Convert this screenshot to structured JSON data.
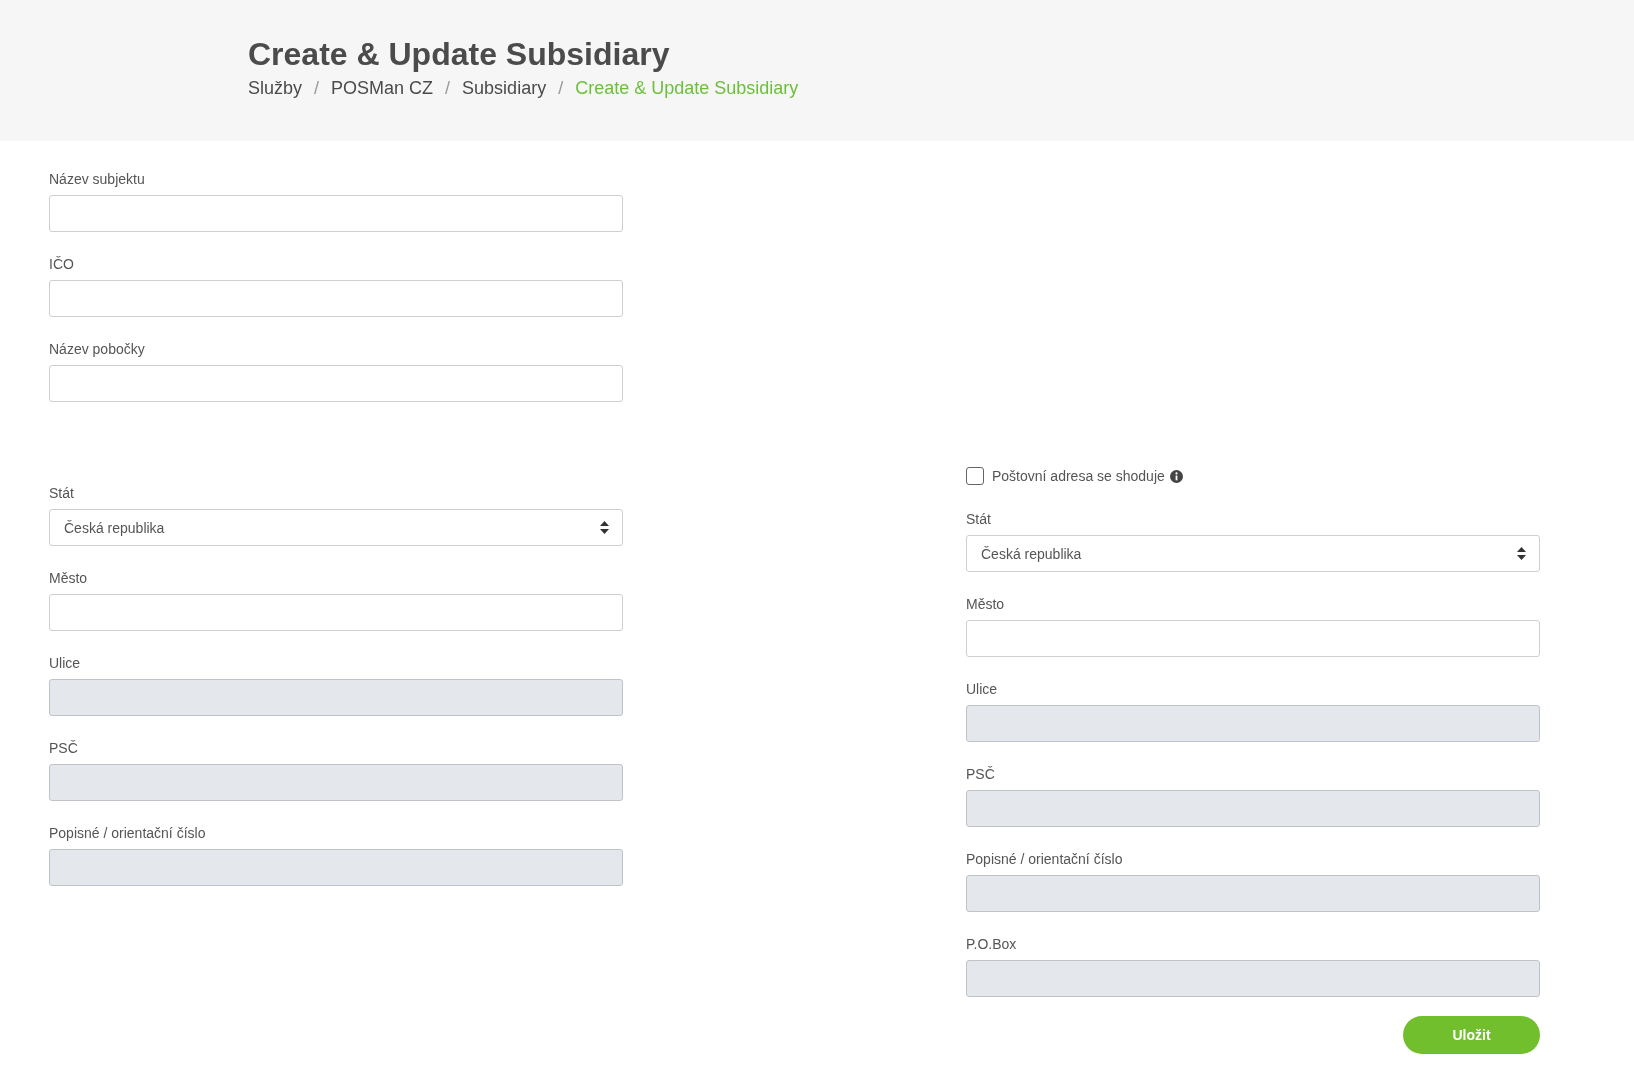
{
  "header": {
    "title": "Create & Update Subsidiary",
    "breadcrumb": [
      {
        "label": "Služby",
        "current": false
      },
      {
        "label": "POSMan CZ",
        "current": false,
        "separator": "/"
      },
      {
        "label": "Subsidiary",
        "current": false,
        "separator": "/"
      },
      {
        "label": "Create & Update Subsidiary",
        "current": true,
        "separator": "/"
      }
    ]
  },
  "left": {
    "groups": [
      {
        "fields": [
          {
            "label": "Název subjektu",
            "kind": "text",
            "disabled": false
          },
          {
            "label": "IČO",
            "kind": "text",
            "disabled": false
          },
          {
            "label": "Název pobočky",
            "kind": "text",
            "disabled": false
          }
        ]
      },
      {
        "fields": [
          {
            "label": "Stát",
            "kind": "select",
            "value": "Česká republika",
            "disabled": false
          },
          {
            "label": "Město",
            "kind": "text",
            "disabled": false
          },
          {
            "label": "Ulice",
            "kind": "text",
            "disabled": true
          },
          {
            "label": "PSČ",
            "kind": "text",
            "disabled": true
          },
          {
            "label": "Popisné / orientační číslo",
            "kind": "text",
            "disabled": true
          }
        ]
      }
    ]
  },
  "right": {
    "checkbox": {
      "label": "Poštovní adresa se shoduje",
      "checked": false
    },
    "fields": [
      {
        "label": "Stát",
        "kind": "select",
        "value": "Česká republika",
        "disabled": false
      },
      {
        "label": "Město",
        "kind": "text",
        "disabled": false
      },
      {
        "label": "Ulice",
        "kind": "text",
        "disabled": true
      },
      {
        "label": "PSČ",
        "kind": "text",
        "disabled": true
      },
      {
        "label": "Popisné / orientační číslo",
        "kind": "text",
        "disabled": true
      },
      {
        "label": "P.O.Box",
        "kind": "text",
        "disabled": true
      }
    ],
    "save_button": "Uložit"
  }
}
